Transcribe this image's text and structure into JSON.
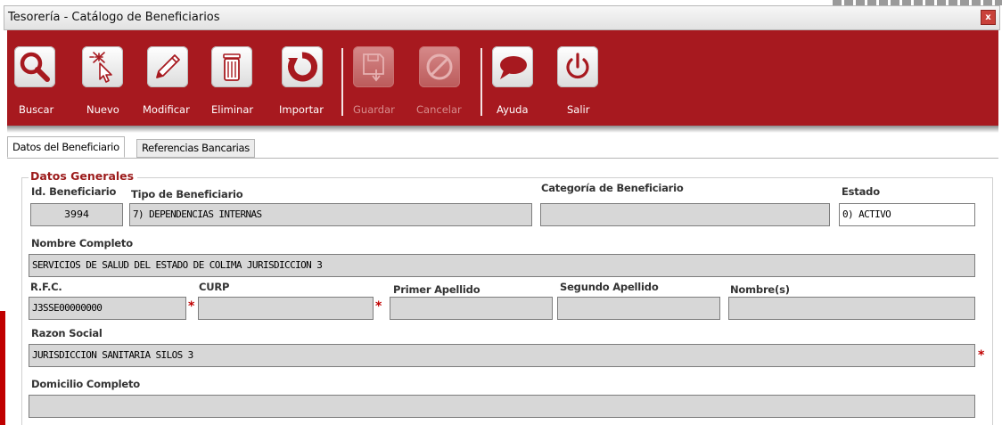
{
  "window": {
    "title": "Tesorería - Catálogo de Beneficiarios",
    "close_glyph": "x"
  },
  "toolbar": {
    "buttons": [
      {
        "label": "Buscar",
        "icon": "magnifier-icon",
        "enabled": true
      },
      {
        "label": "Nuevo",
        "icon": "new-sparkle-cursor-icon",
        "enabled": true
      },
      {
        "label": "Modificar",
        "icon": "pencil-icon",
        "enabled": true
      },
      {
        "label": "Eliminar",
        "icon": "trash-can-icon",
        "enabled": true
      },
      {
        "label": "Importar",
        "icon": "import-refresh-icon",
        "enabled": true
      },
      {
        "label": "Guardar",
        "icon": "save-disk-icon",
        "enabled": false
      },
      {
        "label": "Cancelar",
        "icon": "cancel-circle-icon",
        "enabled": false
      },
      {
        "label": "Ayuda",
        "icon": "speech-bubble-icon",
        "enabled": true
      },
      {
        "label": "Salir",
        "icon": "power-icon",
        "enabled": true
      }
    ]
  },
  "tabs": [
    {
      "label": "Datos del Beneficiario",
      "active": true
    },
    {
      "label": "Referencias Bancarias",
      "active": false
    }
  ],
  "form": {
    "group_title": "Datos Generales",
    "id_beneficiario": {
      "label": "Id. Beneficiario",
      "value": "3994"
    },
    "tipo_beneficiario": {
      "label": "Tipo de Beneficiario",
      "value": "7) DEPENDENCIAS INTERNAS"
    },
    "categoria_beneficiario": {
      "label": "Categoría de Beneficiario",
      "value": ""
    },
    "estado": {
      "label": "Estado",
      "value": "0) ACTIVO"
    },
    "nombre_completo": {
      "label": "Nombre Completo",
      "value": "SERVICIOS DE SALUD DEL ESTADO DE COLIMA JURISDICCION 3"
    },
    "rfc": {
      "label": "R.F.C.",
      "value": "J3SSE00000000"
    },
    "curp": {
      "label": "CURP",
      "value": ""
    },
    "primer_apellido": {
      "label": "Primer Apellido",
      "value": ""
    },
    "segundo_apellido": {
      "label": "Segundo Apellido",
      "value": ""
    },
    "nombres": {
      "label": "Nombre(s)",
      "value": ""
    },
    "razon_social": {
      "label": "Razon Social",
      "value": "JURISDICCION SANITARIA SILOS 3"
    },
    "domicilio_completo": {
      "label": "Domicilio Completo",
      "value": ""
    },
    "required_mark": "*"
  },
  "colors": {
    "toolbar_bg": "#a7191f",
    "group_title": "#9c1b1b",
    "required_mark": "#c00000",
    "field_readonly_bg": "#d7d7d7"
  }
}
